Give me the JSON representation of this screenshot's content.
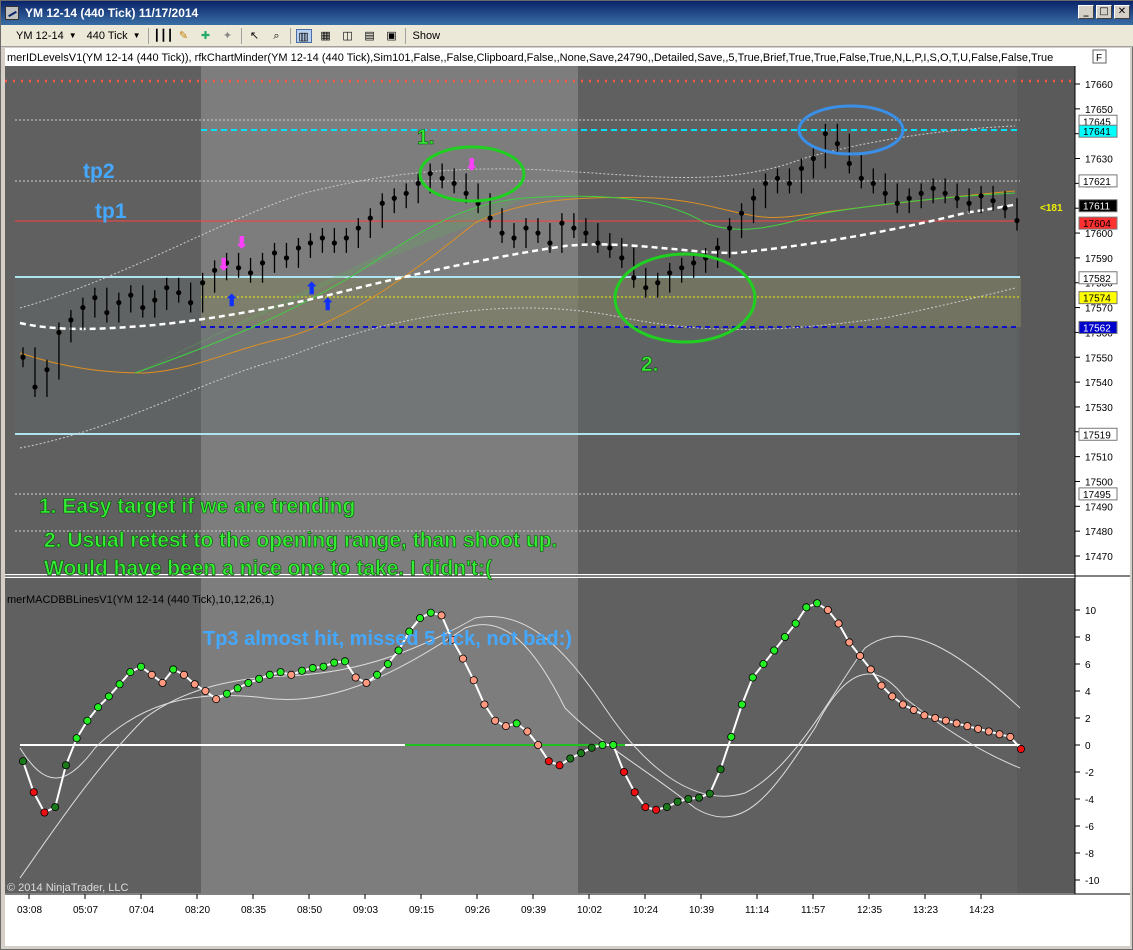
{
  "window": {
    "title": "YM 12-14 (440 Tick)  11/17/2014"
  },
  "toolbar": {
    "instrument": "YM 12-14",
    "interval": "440 Tick",
    "show_label": "Show"
  },
  "indicator_label_top": "merIDLevelsV1(YM 12-14 (440 Tick)), rfkChartMinder(YM 12-14 (440 Tick),Sim101,False,,False,Clipboard,False,,None,Save,24790,,Detailed,Save,,5,True,Brief,True,True,False,True,N,L,P,I,S,O,T,U,False,False,True",
  "indicator_label_bottom": "merMACDBBLinesV1(YM 12-14 (440 Tick),10,12,26,1)",
  "copyright": "© 2014 NinjaTrader, LLC",
  "f_button": "F",
  "annotations": {
    "tp2": "tp2",
    "tp1": "tp1",
    "marker1": "1.",
    "marker2": "2.",
    "note1": "1. Easy target if we are trending",
    "note2a": "2. Usual retest to the opening range, than shoot up.",
    "note2b": "Would have been a nice one to take. I didn't:(",
    "note3": "Tp3 almost hit, missed 5 tick, not bad:)",
    "countdown": "<181"
  },
  "price_axis": {
    "ticks": [
      "17660",
      "17650",
      "17640",
      "17630",
      "17620",
      "17610",
      "17600",
      "17590",
      "17580",
      "17570",
      "17560",
      "17550",
      "17540",
      "17530",
      "17520",
      "17510",
      "17500",
      "17490",
      "17480",
      "17470"
    ]
  },
  "price_badges": [
    {
      "label": "17645",
      "bg": "#ffffff",
      "fg": "#000000"
    },
    {
      "label": "17641",
      "bg": "#00ffff",
      "fg": "#000000"
    },
    {
      "label": "17621",
      "bg": "#ffffff",
      "fg": "#000000"
    },
    {
      "label": "17611",
      "bg": "#000000",
      "fg": "#ffffff"
    },
    {
      "label": "17604",
      "bg": "#ff3030",
      "fg": "#000000"
    },
    {
      "label": "17582",
      "bg": "#ffffff",
      "fg": "#000000"
    },
    {
      "label": "17574",
      "bg": "#ffff00",
      "fg": "#000000"
    },
    {
      "label": "17562",
      "bg": "#0000cc",
      "fg": "#ffffff"
    },
    {
      "label": "17519",
      "bg": "#ffffff",
      "fg": "#000000"
    },
    {
      "label": "17495",
      "bg": "#ffffff",
      "fg": "#000000"
    }
  ],
  "macd_axis": {
    "ticks": [
      "10",
      "8",
      "6",
      "4",
      "2",
      "0",
      "-2",
      "-4",
      "-6",
      "-8",
      "-10"
    ]
  },
  "time_axis": {
    "ticks": [
      "03:08",
      "05:07",
      "07:04",
      "08:20",
      "08:35",
      "08:50",
      "09:03",
      "09:15",
      "09:26",
      "09:39",
      "10:02",
      "10:24",
      "10:39",
      "11:14",
      "11:57",
      "12:35",
      "13:23",
      "14:23"
    ]
  },
  "colors": {
    "panel_dark": "#606060",
    "panel_light": "#7d7d7d",
    "grid": "#9a9a9a",
    "annotation_green": "#33ee33",
    "annotation_blue": "#44a8ff"
  },
  "chart_data": {
    "type": "candlestick",
    "price_closes": [
      17550,
      17538,
      17545,
      17560,
      17565,
      17570,
      17574,
      17568,
      17572,
      17575,
      17570,
      17573,
      17578,
      17576,
      17572,
      17580,
      17585,
      17588,
      17586,
      17584,
      17588,
      17592,
      17590,
      17594,
      17596,
      17598,
      17596,
      17598,
      17602,
      17606,
      17612,
      17614,
      17616,
      17620,
      17624,
      17622,
      17620,
      17616,
      17612,
      17606,
      17600,
      17598,
      17602,
      17600,
      17596,
      17604,
      17602,
      17600,
      17596,
      17594,
      17590,
      17582,
      17578,
      17580,
      17584,
      17586,
      17588,
      17590,
      17594,
      17602,
      17608,
      17614,
      17620,
      17622,
      17620,
      17626,
      17630,
      17640,
      17636,
      17628,
      17622,
      17620,
      17616,
      17612,
      17614,
      17616,
      17618,
      17616,
      17614,
      17612,
      17615,
      17613,
      17610,
      17605
    ],
    "macd_values": [
      -1.2,
      -3.5,
      -5,
      -4.6,
      -1.5,
      0.5,
      1.8,
      2.8,
      3.6,
      4.5,
      5.4,
      5.8,
      5.2,
      4.6,
      5.6,
      5.2,
      4.5,
      4.0,
      3.4,
      3.8,
      4.2,
      4.6,
      4.9,
      5.2,
      5.4,
      5.2,
      5.5,
      5.7,
      5.8,
      6.1,
      6.2,
      5.0,
      4.6,
      5.2,
      6.0,
      7.0,
      8.4,
      9.4,
      9.8,
      9.6,
      7.8,
      6.4,
      4.8,
      3.0,
      1.8,
      1.4,
      1.6,
      1.0,
      0,
      -1.2,
      -1.5,
      -1,
      -0.6,
      -0.2,
      0,
      0,
      -2,
      -3.5,
      -4.6,
      -4.8,
      -4.6,
      -4.2,
      -4.0,
      -3.9,
      -3.6,
      -1.8,
      0.6,
      3.0,
      5.0,
      6.0,
      7.0,
      8.0,
      9.0,
      10.2,
      10.5,
      10.0,
      9.0,
      7.6,
      6.6,
      5.6,
      4.4,
      3.6,
      3.0,
      2.6,
      2.2,
      2.0,
      1.8,
      1.6,
      1.4,
      1.2,
      1.0,
      0.8,
      0.6,
      -0.3
    ]
  }
}
